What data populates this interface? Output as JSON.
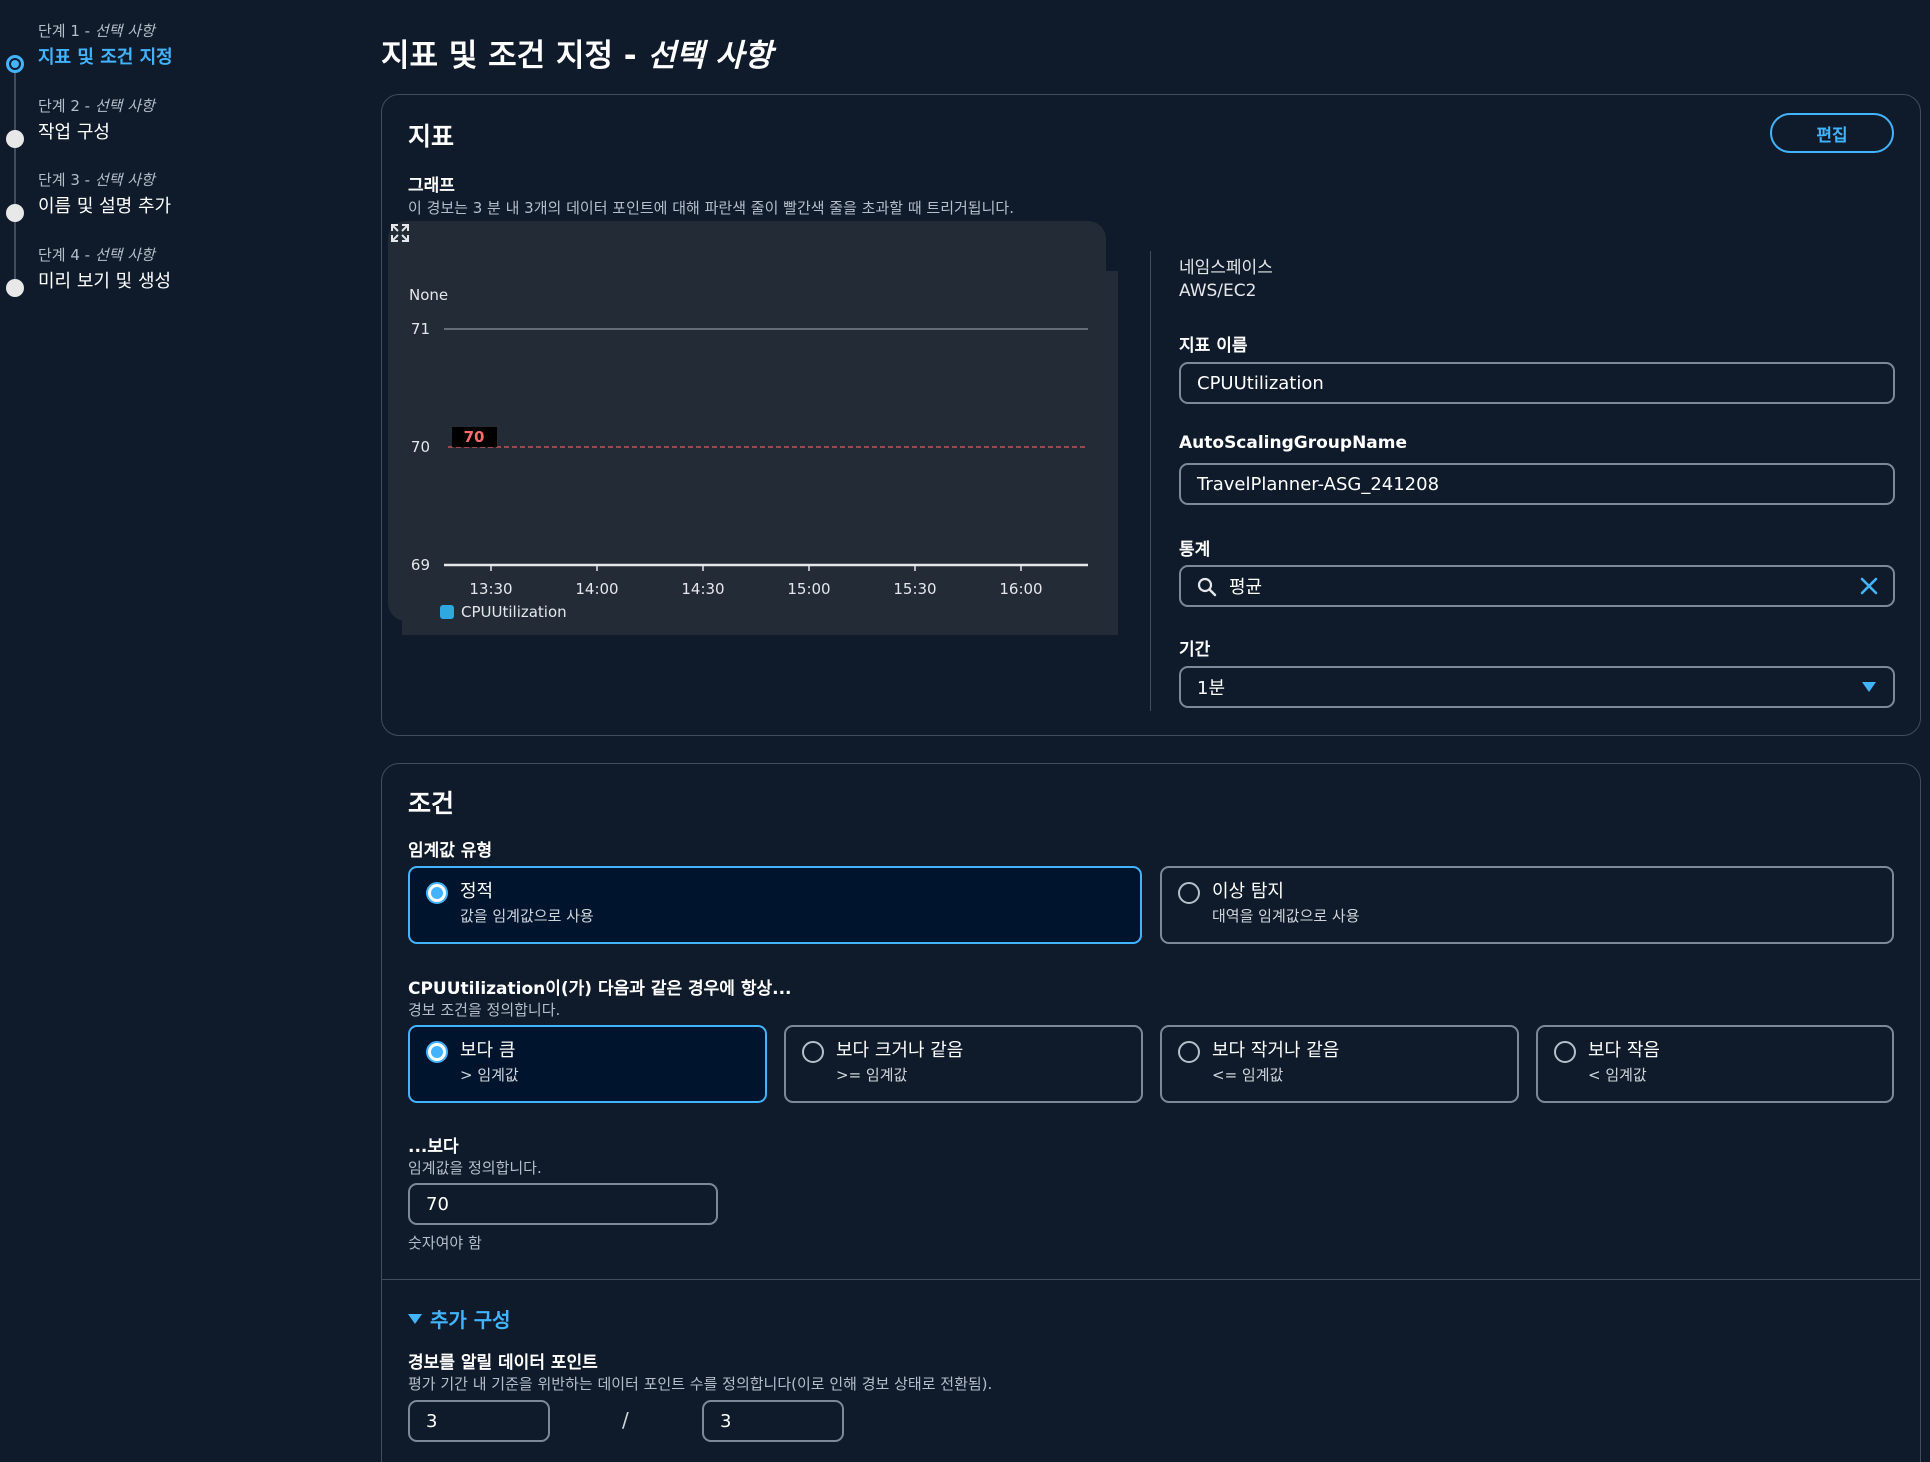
{
  "steps": [
    {
      "num": "단계 1 - ",
      "optional": "선택 사항",
      "title": "지표 및 조건 지정"
    },
    {
      "num": "단계 2 - ",
      "optional": "선택 사항",
      "title": "작업 구성"
    },
    {
      "num": "단계 3 - ",
      "optional": "선택 사항",
      "title": "이름 및 설명 추가"
    },
    {
      "num": "단계 4 - ",
      "optional": "선택 사항",
      "title": "미리 보기 및 생성"
    }
  ],
  "page": {
    "title": "지표 및 조건 지정 - ",
    "title_optional": "선택 사항"
  },
  "metric": {
    "title": "지표",
    "edit_label": "편집",
    "graph_label": "그래프",
    "graph_desc": "이 경보는 3 분 내 3개의 데이터 포인트에 대해 파란색 줄이 빨간색 줄을 초과할 때 트리거됩니다.",
    "namespace_label": "네임스페이스",
    "namespace_value": "AWS/EC2",
    "metric_name_label": "지표 이름",
    "metric_name_value": "CPUUtilization",
    "asg_label": "AutoScalingGroupName",
    "asg_value": "TravelPlanner-ASG_241208",
    "stat_label": "통계",
    "stat_value": "평균",
    "period_label": "기간",
    "period_value": "1분"
  },
  "chart_data": {
    "type": "line",
    "ylabel": "None",
    "ylim": [
      69,
      71
    ],
    "y_ticks": [
      "71",
      "70",
      "69"
    ],
    "x_ticks": [
      "13:30",
      "14:00",
      "14:30",
      "15:00",
      "15:30",
      "16:00"
    ],
    "threshold": 70,
    "threshold_label": "70",
    "series": [
      {
        "name": "CPUUtilization",
        "color": "#2ea8e0",
        "values": []
      }
    ]
  },
  "conditions": {
    "title": "조건",
    "threshold_type_label": "임계값 유형",
    "threshold_types": [
      {
        "title": "정적",
        "desc": "값을 임계값으로 사용",
        "selected": true
      },
      {
        "title": "이상 탐지",
        "desc": "대역을 임계값으로 사용",
        "selected": false
      }
    ],
    "whenever_label": "CPUUtilization이(가) 다음과 같은 경우에 항상...",
    "whenever_desc": "경보 조건을 정의합니다.",
    "operators": [
      {
        "title": "보다 큼",
        "desc": "> 임계값",
        "selected": true
      },
      {
        "title": "보다 크거나 같음",
        "desc": ">= 임계값",
        "selected": false
      },
      {
        "title": "보다 작거나 같음",
        "desc": "<= 임계값",
        "selected": false
      },
      {
        "title": "보다 작음",
        "desc": "< 임계값",
        "selected": false
      }
    ],
    "than_label": "...보다",
    "than_desc": "임계값을 정의합니다.",
    "than_value": "70",
    "than_hint": "숫자여야 함",
    "additional_label": "추가 구성",
    "datapoints_label": "경보를 알릴 데이터 포인트",
    "datapoints_desc": "평가 기간 내 기준을 위반하는 데이터 포인트 수를 정의합니다(이로 인해 경보 상태로 전환됨).",
    "datapoints_value": "3",
    "datapoints_slash": "/",
    "datapoints_out_of": "3"
  },
  "colors": {
    "accent": "#42b4ff",
    "threshold": "#e05a5a",
    "background": "#0f1b2a"
  }
}
